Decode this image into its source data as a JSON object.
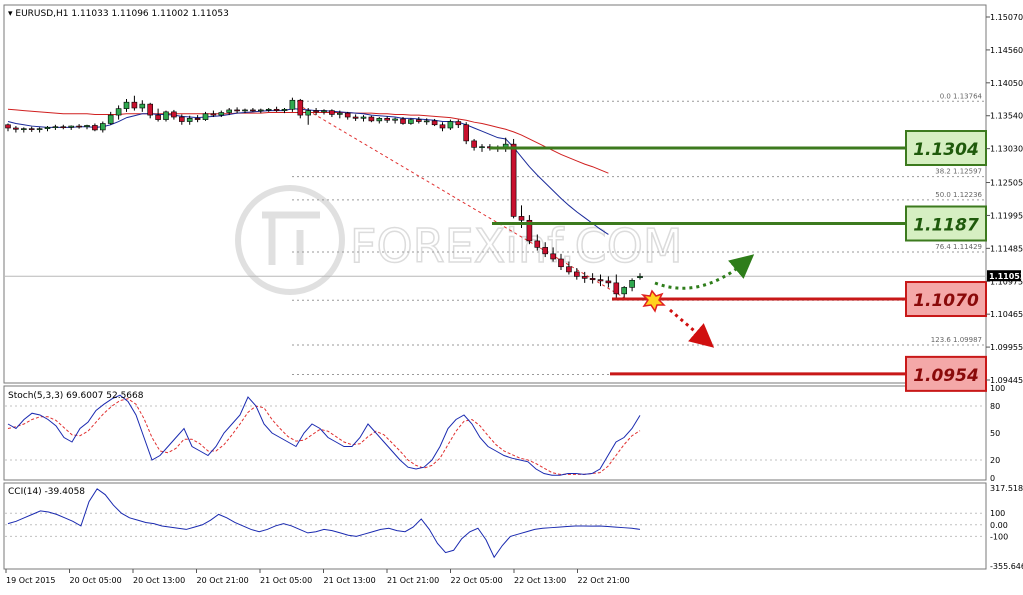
{
  "chart_data": {
    "type": "candlestick",
    "symbol_line": "EURUSD,H1  1.11033 1.11096 1.11002 1.11053",
    "current_price": "1.11053",
    "price_axis_labels": [
      "1.15070",
      "1.14560",
      "1.14050",
      "1.13540",
      "1.13030",
      "1.12505",
      "1.11995",
      "1.11485",
      "1.10975",
      "1.10465",
      "1.09955",
      "1.09445"
    ],
    "time_axis_labels": [
      "19 Oct 2015",
      "20 Oct 05:00",
      "20 Oct 13:00",
      "20 Oct 21:00",
      "21 Oct 05:00",
      "21 Oct 13:00",
      "21 Oct 21:00",
      "22 Oct 05:00",
      "22 Oct 13:00",
      "22 Oct 21:00"
    ],
    "candles": [
      [
        1.134,
        1.1342,
        1.133,
        1.1335
      ],
      [
        1.1335,
        1.1338,
        1.1328,
        1.1333
      ],
      [
        1.1333,
        1.1336,
        1.1328,
        1.1334
      ],
      [
        1.1334,
        1.1337,
        1.1329,
        1.1333
      ],
      [
        1.1333,
        1.1336,
        1.1328,
        1.1334
      ],
      [
        1.1334,
        1.1338,
        1.133,
        1.1336
      ],
      [
        1.1336,
        1.134,
        1.1332,
        1.1337
      ],
      [
        1.1337,
        1.134,
        1.1333,
        1.1336
      ],
      [
        1.1336,
        1.1339,
        1.1332,
        1.1338
      ],
      [
        1.1338,
        1.1341,
        1.1334,
        1.1337
      ],
      [
        1.1337,
        1.134,
        1.1333,
        1.1339
      ],
      [
        1.1339,
        1.1342,
        1.133,
        1.1332
      ],
      [
        1.1332,
        1.1345,
        1.1328,
        1.1342
      ],
      [
        1.1342,
        1.136,
        1.134,
        1.1355
      ],
      [
        1.1355,
        1.137,
        1.1348,
        1.1365
      ],
      [
        1.1365,
        1.138,
        1.136,
        1.1375
      ],
      [
        1.1375,
        1.1385,
        1.1362,
        1.1366
      ],
      [
        1.1366,
        1.1378,
        1.136,
        1.1372
      ],
      [
        1.1372,
        1.1374,
        1.135,
        1.1355
      ],
      [
        1.1355,
        1.1365,
        1.1345,
        1.1348
      ],
      [
        1.1348,
        1.1362,
        1.1345,
        1.136
      ],
      [
        1.136,
        1.1363,
        1.1348,
        1.1352
      ],
      [
        1.1352,
        1.1356,
        1.134,
        1.1345
      ],
      [
        1.1345,
        1.1354,
        1.134,
        1.135
      ],
      [
        1.135,
        1.1355,
        1.1344,
        1.1348
      ],
      [
        1.1348,
        1.136,
        1.1346,
        1.1357
      ],
      [
        1.1357,
        1.1362,
        1.1352,
        1.1355
      ],
      [
        1.1355,
        1.1362,
        1.1352,
        1.1359
      ],
      [
        1.1359,
        1.1366,
        1.1355,
        1.1363
      ],
      [
        1.1363,
        1.1367,
        1.1358,
        1.1362
      ],
      [
        1.1362,
        1.1365,
        1.1358,
        1.1363
      ],
      [
        1.1363,
        1.1366,
        1.136,
        1.1362
      ],
      [
        1.1362,
        1.1365,
        1.1358,
        1.1363
      ],
      [
        1.1363,
        1.1366,
        1.136,
        1.1364
      ],
      [
        1.1364,
        1.1368,
        1.136,
        1.1362
      ],
      [
        1.1362,
        1.1366,
        1.1358,
        1.1364
      ],
      [
        1.1364,
        1.1382,
        1.136,
        1.1378
      ],
      [
        1.1378,
        1.138,
        1.135,
        1.1355
      ],
      [
        1.1355,
        1.1366,
        1.134,
        1.1362
      ],
      [
        1.1362,
        1.1366,
        1.1355,
        1.136
      ],
      [
        1.136,
        1.1364,
        1.1356,
        1.1362
      ],
      [
        1.1362,
        1.1364,
        1.1352,
        1.1356
      ],
      [
        1.1356,
        1.1362,
        1.135,
        1.1358
      ],
      [
        1.1358,
        1.136,
        1.1348,
        1.1352
      ],
      [
        1.1352,
        1.1356,
        1.1346,
        1.135
      ],
      [
        1.135,
        1.1355,
        1.1345,
        1.1352
      ],
      [
        1.1352,
        1.1354,
        1.1344,
        1.1346
      ],
      [
        1.1346,
        1.1352,
        1.1342,
        1.135
      ],
      [
        1.135,
        1.1353,
        1.1343,
        1.1347
      ],
      [
        1.1347,
        1.1351,
        1.1342,
        1.1349
      ],
      [
        1.1349,
        1.1352,
        1.134,
        1.1342
      ],
      [
        1.1342,
        1.135,
        1.134,
        1.1348
      ],
      [
        1.1348,
        1.1352,
        1.1342,
        1.1345
      ],
      [
        1.1345,
        1.135,
        1.134,
        1.1346
      ],
      [
        1.1346,
        1.1349,
        1.1338,
        1.134
      ],
      [
        1.134,
        1.1344,
        1.133,
        1.1335
      ],
      [
        1.1335,
        1.1348,
        1.1332,
        1.1345
      ],
      [
        1.1345,
        1.1348,
        1.1335,
        1.134
      ],
      [
        1.134,
        1.1344,
        1.131,
        1.1315
      ],
      [
        1.1315,
        1.1318,
        1.13,
        1.1305
      ],
      [
        1.1305,
        1.131,
        1.1298,
        1.1306
      ],
      [
        1.1306,
        1.131,
        1.13,
        1.1304
      ],
      [
        1.1304,
        1.1308,
        1.1298,
        1.1305
      ],
      [
        1.1305,
        1.132,
        1.1298,
        1.131
      ],
      [
        1.131,
        1.1318,
        1.1195,
        1.1198
      ],
      [
        1.1198,
        1.1215,
        1.118,
        1.1192
      ],
      [
        1.1192,
        1.12,
        1.1155,
        1.116
      ],
      [
        1.116,
        1.117,
        1.1145,
        1.115
      ],
      [
        1.115,
        1.1158,
        1.1135,
        1.114
      ],
      [
        1.114,
        1.115,
        1.1128,
        1.1132
      ],
      [
        1.1132,
        1.114,
        1.1115,
        1.112
      ],
      [
        1.112,
        1.1128,
        1.1108,
        1.1112
      ],
      [
        1.1112,
        1.1118,
        1.11,
        1.1105
      ],
      [
        1.1105,
        1.1112,
        1.1095,
        1.1102
      ],
      [
        1.1102,
        1.111,
        1.1094,
        1.11
      ],
      [
        1.11,
        1.1108,
        1.109,
        1.1098
      ],
      [
        1.1098,
        1.1105,
        1.1088,
        1.1095
      ],
      [
        1.1095,
        1.1108,
        1.1072,
        1.1078
      ],
      [
        1.1078,
        1.109,
        1.107,
        1.1088
      ],
      [
        1.1088,
        1.1102,
        1.1082,
        1.1099
      ],
      [
        1.1103,
        1.111,
        1.11,
        1.1105
      ]
    ],
    "fast_ma": [
      1.1345,
      1.1342,
      1.134,
      1.1338,
      1.1337,
      1.1336,
      1.1336,
      1.1336,
      1.1336,
      1.1337,
      1.1337,
      1.1336,
      1.1337,
      1.134,
      1.1345,
      1.1351,
      1.1354,
      1.1357,
      1.1357,
      1.1356,
      1.1356,
      1.1355,
      1.1353,
      1.1352,
      1.1351,
      1.1352,
      1.1353,
      1.1354,
      1.1356,
      1.1358,
      1.1359,
      1.136,
      1.1361,
      1.1362,
      1.1362,
      1.1362,
      1.1365,
      1.1364,
      1.1363,
      1.1362,
      1.1362,
      1.1361,
      1.136,
      1.1359,
      1.1358,
      1.1357,
      1.1355,
      1.1354,
      1.1353,
      1.1352,
      1.135,
      1.135,
      1.1349,
      1.1348,
      1.1347,
      1.1345,
      1.1345,
      1.1344,
      1.134,
      1.1335,
      1.133,
      1.1325,
      1.132,
      1.1318,
      1.1305,
      1.129,
      1.1275,
      1.1262,
      1.125,
      1.1238,
      1.1226,
      1.1215,
      1.1205,
      1.1196,
      1.1187,
      1.1178,
      1.117
    ],
    "slow_ma": [
      1.1364,
      1.1363,
      1.1362,
      1.1361,
      1.136,
      1.1359,
      1.1358,
      1.1357,
      1.1357,
      1.1357,
      1.1357,
      1.1356,
      1.1356,
      1.1356,
      1.1356,
      1.1357,
      1.1357,
      1.1357,
      1.1357,
      1.1357,
      1.1357,
      1.1357,
      1.1357,
      1.1357,
      1.1357,
      1.1357,
      1.1357,
      1.1357,
      1.1357,
      1.1358,
      1.1358,
      1.1358,
      1.1358,
      1.1359,
      1.1359,
      1.1359,
      1.1359,
      1.1359,
      1.1359,
      1.1359,
      1.1359,
      1.1359,
      1.1359,
      1.1359,
      1.1358,
      1.1358,
      1.1358,
      1.1357,
      1.1357,
      1.1356,
      1.1356,
      1.1355,
      1.1355,
      1.1354,
      1.1353,
      1.1352,
      1.1351,
      1.1349,
      1.1347,
      1.1344,
      1.1342,
      1.1339,
      1.1336,
      1.1333,
      1.1329,
      1.1324,
      1.1318,
      1.1312,
      1.1306,
      1.13,
      1.1294,
      1.1289,
      1.1284,
      1.1279,
      1.1275,
      1.127,
      1.1265
    ],
    "fib_levels": [
      {
        "text": "0.0   1.13764",
        "price": 1.13764
      },
      {
        "text": "38.2   1.12597",
        "price": 1.12597
      },
      {
        "text": "50.0   1.12236",
        "price": 1.12236
      },
      {
        "text": "76.4   1.11429",
        "price": 1.11429
      },
      {
        "text": "123.6  1.09987",
        "price": 1.09987
      }
    ],
    "level_boxes": [
      {
        "label": "1.1304",
        "price": 1.1304,
        "color": "green"
      },
      {
        "label": "1.1187",
        "price": 1.1187,
        "color": "green"
      },
      {
        "label": "1.1070",
        "price": 1.107,
        "color": "red"
      },
      {
        "label": "1.0954",
        "price": 1.0954,
        "color": "red"
      }
    ],
    "watermark": "FOREXinf.COM",
    "stoch": {
      "label": "Stoch(5,3,3) 69.6007 52.5668",
      "axis_labels": [
        "100",
        "80",
        "50",
        "20",
        "0"
      ],
      "main": [
        60,
        55,
        65,
        72,
        70,
        65,
        58,
        45,
        40,
        55,
        62,
        75,
        82,
        88,
        92,
        85,
        70,
        45,
        20,
        25,
        35,
        45,
        55,
        35,
        30,
        25,
        35,
        50,
        60,
        70,
        90,
        80,
        60,
        50,
        45,
        40,
        35,
        50,
        60,
        55,
        45,
        40,
        35,
        35,
        45,
        60,
        50,
        40,
        30,
        20,
        12,
        10,
        12,
        20,
        35,
        55,
        65,
        70,
        60,
        45,
        35,
        30,
        25,
        22,
        20,
        18,
        10,
        5,
        3,
        3,
        5,
        5,
        4,
        5,
        10,
        25,
        40,
        45,
        55,
        69.6
      ],
      "signal": [
        55,
        57,
        60,
        65,
        68,
        68,
        64,
        56,
        48,
        47,
        52,
        62,
        72,
        80,
        86,
        88,
        82,
        66,
        45,
        30,
        28,
        33,
        43,
        43,
        38,
        30,
        30,
        37,
        48,
        60,
        73,
        80,
        78,
        65,
        55,
        46,
        41,
        42,
        48,
        54,
        52,
        46,
        40,
        37,
        38,
        46,
        52,
        48,
        39,
        30,
        20,
        14,
        11,
        14,
        22,
        37,
        52,
        63,
        65,
        58,
        47,
        37,
        30,
        26,
        22,
        20,
        16,
        11,
        6,
        4,
        4,
        4,
        4,
        5,
        6,
        13,
        25,
        37,
        47,
        52.6
      ]
    },
    "cci": {
      "label": "CCI(14) -39.4058",
      "axis_labels": [
        "317.518",
        "100",
        "0.00",
        "-100",
        "-355.646"
      ],
      "values": [
        10,
        30,
        60,
        90,
        120,
        110,
        90,
        60,
        30,
        -10,
        200,
        310,
        260,
        170,
        100,
        60,
        40,
        20,
        10,
        -10,
        -20,
        -30,
        -40,
        -20,
        0,
        40,
        90,
        60,
        20,
        -10,
        -40,
        -60,
        -40,
        -10,
        10,
        -10,
        -40,
        -70,
        -60,
        -40,
        -50,
        -70,
        -90,
        -100,
        -80,
        -60,
        -40,
        -30,
        -50,
        -60,
        -20,
        50,
        -40,
        -160,
        -240,
        -220,
        -120,
        -60,
        -30,
        -130,
        -280,
        -180,
        -100,
        -80,
        -60,
        -40,
        -30,
        -25,
        -20,
        -15,
        -10,
        -10,
        -12,
        -10,
        -15,
        -20,
        -25,
        -30,
        -39.4
      ]
    }
  }
}
